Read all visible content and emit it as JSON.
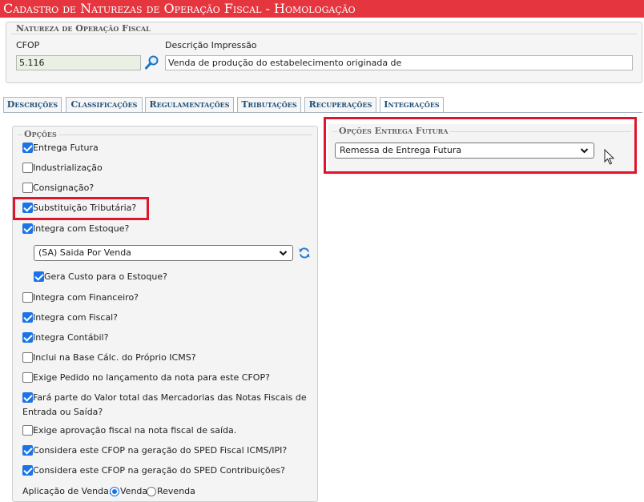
{
  "window": {
    "title": "Cadastro de Naturezas de Operação Fiscal  - Homologação",
    "title_color": "#e5363f"
  },
  "header": {
    "legend": "Natureza de Operação Fiscal",
    "cfop_label": "CFOP",
    "cfop_value": "5.116",
    "search_icon": "magnifier-icon",
    "descricao_label": "Descrição Impressão",
    "descricao_value": "Venda de produção do estabelecimento originada de"
  },
  "tabs": [
    {
      "label": "Descrições",
      "active": false
    },
    {
      "label": "Classificações",
      "active": false
    },
    {
      "label": "Regulamentações",
      "active": false
    },
    {
      "label": "Tributações",
      "active": false
    },
    {
      "label": "Recuperações",
      "active": false
    },
    {
      "label": "Integrações",
      "active": true
    }
  ],
  "opcoes": {
    "legend": "Opções",
    "items": [
      {
        "label": "Entrega Futura",
        "checked": true
      },
      {
        "label": "Industrialização",
        "checked": false
      },
      {
        "label": "Consignação?",
        "checked": false
      },
      {
        "label": "Substituição Tributária?",
        "checked": true
      },
      {
        "label": "Integra com Estoque?",
        "checked": true
      },
      {
        "label": "Gera Custo para o Estoque?",
        "checked": true
      },
      {
        "label": "Integra com Financeiro?",
        "checked": false
      },
      {
        "label": "Integra com Fiscal?",
        "checked": true
      },
      {
        "label": "Integra Contábil?",
        "checked": true
      },
      {
        "label": "Inclui na Base Cálc. do Próprio ICMS?",
        "checked": false
      },
      {
        "label": "Exige Pedido no lançamento da nota para este CFOP?",
        "checked": false
      },
      {
        "label": "Fará parte do Valor total das Mercadorias das Notas Fiscais de",
        "label2": "Entrada ou Saída?",
        "checked": true
      },
      {
        "label": "Exige aprovação fiscal na nota fiscal de saída.",
        "checked": false
      },
      {
        "label": "Considera este CFOP na geração do SPED Fiscal ICMS/IPI?",
        "checked": true
      },
      {
        "label": "Considera este CFOP na geração do SPED Contribuições?",
        "checked": true
      }
    ],
    "estoque_select": "(SA) Saida Por Venda",
    "refresh_icon": "refresh-icon",
    "aplicacao_label": "Aplicação de Venda:",
    "aplicacao_options": [
      {
        "label": "Venda",
        "selected": true
      },
      {
        "label": "Revenda",
        "selected": false
      }
    ]
  },
  "entrega_futura": {
    "legend": "Opções Entrega Futura",
    "select_value": "Remessa de Entrega Futura"
  },
  "colors": {
    "highlight": "#e0142b",
    "tab_text": "#1f4f78",
    "checkbox": "#1a73e8"
  }
}
